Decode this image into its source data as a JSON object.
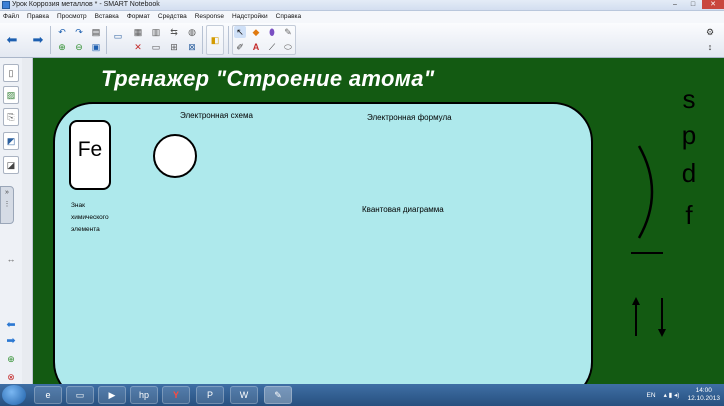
{
  "window": {
    "title": "Урок Коррозия металлов * - SMART Notebook",
    "minimize": "–",
    "maximize": "□",
    "close": "✕"
  },
  "menu": [
    "Файл",
    "Правка",
    "Просмотр",
    "Вставка",
    "Формат",
    "Средства",
    "Response",
    "Надстройки",
    "Справка"
  ],
  "slide": {
    "title": "Тренажер \"Строение атома\"",
    "element_symbol": "Fe",
    "label_electron_scheme": "Электронная схема",
    "label_electron_formula": "Электронная формула",
    "label_quantum_diagram": "Квантовая диаграмма",
    "label_sign_line1": "Знак",
    "label_sign_line2": "химического",
    "label_sign_line3": "элемента",
    "orbital_s": "s",
    "orbital_p": "p",
    "orbital_d": "d",
    "orbital_f": "f"
  },
  "taskbar": {
    "lang": "EN",
    "time": "14:00",
    "date": "12.10.2013"
  },
  "colors": {
    "canvas_bg": "#135a12",
    "panel_bg": "#aee9ec",
    "title_text": "#ffffff"
  }
}
